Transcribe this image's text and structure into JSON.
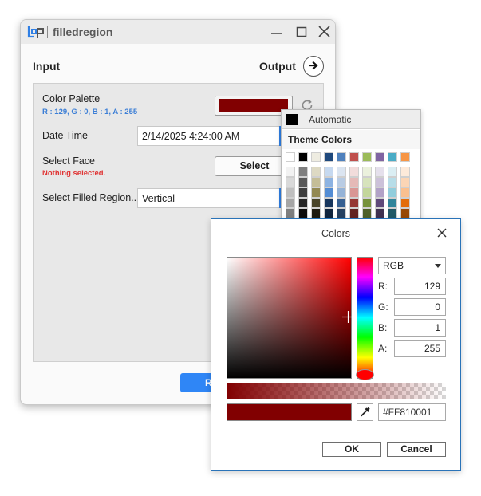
{
  "app": {
    "title": "filledregion"
  },
  "colors": {
    "accent": "#2f86f6",
    "selected_color": "#810001",
    "warning": "#e03434",
    "info": "#3d7fd6"
  },
  "window_controls": {
    "minimize": "minimize-icon",
    "maximize": "maximize-icon",
    "close": "close-icon"
  },
  "header": {
    "input_label": "Input",
    "output_label": "Output",
    "output_icon": "arrow-right-icon"
  },
  "fields": {
    "color_palette": {
      "label": "Color Palette",
      "value_text": "R : 129, G : 0, B : 1, A : 255",
      "refresh_icon": "refresh-icon"
    },
    "date_time": {
      "label": "Date Time",
      "value": "2/14/2025 4:24:00 AM"
    },
    "select_face": {
      "label": "Select Face",
      "status": "Nothing selected.",
      "button_label": "Select"
    },
    "filled_region": {
      "label": "Select Filled Region...",
      "value": "Vertical"
    }
  },
  "run_button": {
    "label": "R"
  },
  "palette_popup": {
    "automatic_label": "Automatic",
    "theme_colors_label": "Theme Colors",
    "theme_colors": [
      "#ffffff",
      "#000000",
      "#eeece1",
      "#1f497d",
      "#4f81bd",
      "#c0504d",
      "#9bbb59",
      "#8064a2",
      "#4bacc6",
      "#f79646"
    ],
    "shade_columns": [
      [
        "#f2f2f2",
        "#d9d9d9",
        "#bfbfbf",
        "#a6a6a6",
        "#7f7f7f"
      ],
      [
        "#7f7f7f",
        "#595959",
        "#3f3f3f",
        "#262626",
        "#0c0c0c"
      ],
      [
        "#ddd9c3",
        "#c4bd97",
        "#938953",
        "#494429",
        "#1d1b10"
      ],
      [
        "#c6d9f0",
        "#8db3e2",
        "#548dd4",
        "#17365d",
        "#0f243e"
      ],
      [
        "#dbe5f1",
        "#b8cce4",
        "#95b3d7",
        "#366092",
        "#244061"
      ],
      [
        "#f2dcdb",
        "#e5b9b7",
        "#d99694",
        "#953734",
        "#632423"
      ],
      [
        "#ebf1dd",
        "#d7e3bc",
        "#c3d69b",
        "#76923c",
        "#4f6128"
      ],
      [
        "#e5e0ec",
        "#ccc1d9",
        "#b2a2c7",
        "#5f497a",
        "#3f3151"
      ],
      [
        "#dbeef3",
        "#b7dde8",
        "#92cddc",
        "#31859b",
        "#205867"
      ],
      [
        "#fdeada",
        "#fbd5b5",
        "#fac08f",
        "#e36c09",
        "#974806"
      ]
    ]
  },
  "color_dialog": {
    "title": "Colors",
    "close_icon": "close-icon",
    "mode": "RGB",
    "channels": [
      {
        "label": "R:",
        "value": "129"
      },
      {
        "label": "G:",
        "value": "0"
      },
      {
        "label": "B:",
        "value": "1"
      },
      {
        "label": "A:",
        "value": "255"
      }
    ],
    "hex": "#FF810001",
    "eyedropper_icon": "eyedropper-icon",
    "ok_label": "OK",
    "cancel_label": "Cancel"
  }
}
